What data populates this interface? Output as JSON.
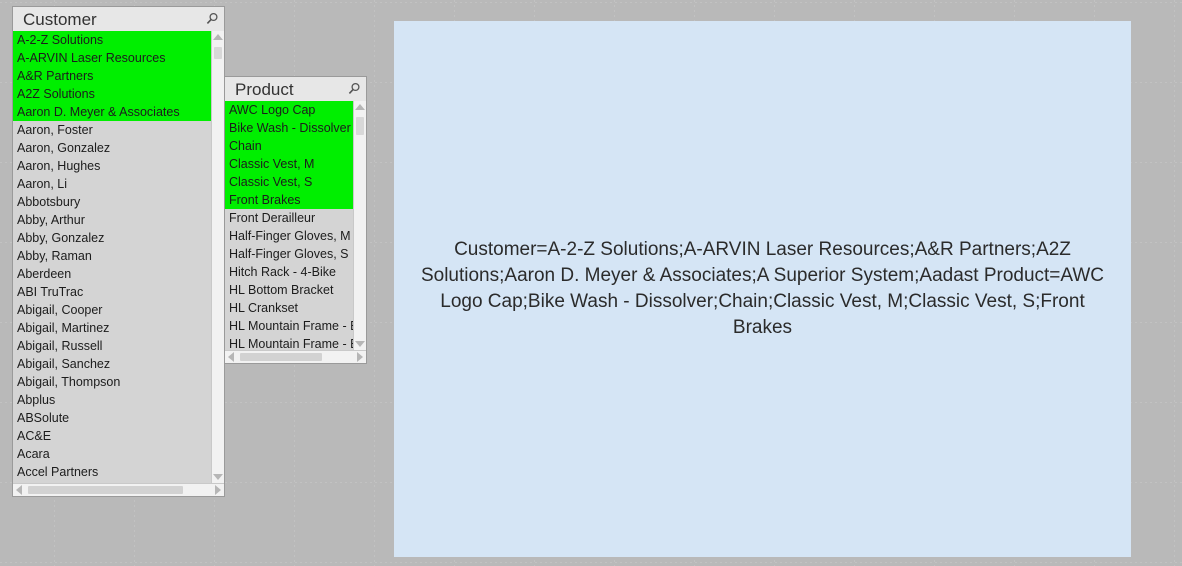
{
  "customer_listbox": {
    "title": "Customer",
    "search_icon": "search-icon",
    "items": [
      {
        "label": "A-2-Z Solutions",
        "selected": true
      },
      {
        "label": "A-ARVIN Laser Resources",
        "selected": true
      },
      {
        "label": "A&R Partners",
        "selected": true
      },
      {
        "label": "A2Z Solutions",
        "selected": true
      },
      {
        "label": "Aaron D. Meyer & Associates",
        "selected": true
      },
      {
        "label": "Aaron, Foster",
        "selected": false
      },
      {
        "label": "Aaron, Gonzalez",
        "selected": false
      },
      {
        "label": "Aaron, Hughes",
        "selected": false
      },
      {
        "label": "Aaron, Li",
        "selected": false
      },
      {
        "label": "Abbotsbury",
        "selected": false
      },
      {
        "label": "Abby, Arthur",
        "selected": false
      },
      {
        "label": "Abby, Gonzalez",
        "selected": false
      },
      {
        "label": "Abby, Raman",
        "selected": false
      },
      {
        "label": "Aberdeen",
        "selected": false
      },
      {
        "label": "ABI TruTrac",
        "selected": false
      },
      {
        "label": "Abigail, Cooper",
        "selected": false
      },
      {
        "label": "Abigail, Martinez",
        "selected": false
      },
      {
        "label": "Abigail, Russell",
        "selected": false
      },
      {
        "label": "Abigail, Sanchez",
        "selected": false
      },
      {
        "label": "Abigail, Thompson",
        "selected": false
      },
      {
        "label": "Abplus",
        "selected": false
      },
      {
        "label": "ABSolute",
        "selected": false
      },
      {
        "label": "AC&E",
        "selected": false
      },
      {
        "label": "Acara",
        "selected": false
      },
      {
        "label": "Accel Partners",
        "selected": false
      }
    ]
  },
  "product_listbox": {
    "title": "Product",
    "search_icon": "search-icon",
    "items": [
      {
        "label": "AWC Logo Cap",
        "selected": true
      },
      {
        "label": "Bike Wash - Dissolver",
        "selected": true
      },
      {
        "label": "Chain",
        "selected": true
      },
      {
        "label": "Classic Vest, M",
        "selected": true
      },
      {
        "label": "Classic Vest, S",
        "selected": true
      },
      {
        "label": "Front Brakes",
        "selected": true
      },
      {
        "label": "Front Derailleur",
        "selected": false
      },
      {
        "label": "Half-Finger Gloves, M",
        "selected": false
      },
      {
        "label": "Half-Finger Gloves, S",
        "selected": false
      },
      {
        "label": "Hitch Rack - 4-Bike",
        "selected": false
      },
      {
        "label": "HL Bottom Bracket",
        "selected": false
      },
      {
        "label": "HL Crankset",
        "selected": false
      },
      {
        "label": "HL Mountain Frame - B",
        "selected": false
      },
      {
        "label": "HL Mountain Frame - B",
        "selected": false
      }
    ]
  },
  "text_object": {
    "content": "Customer=A-2-Z Solutions;A-ARVIN Laser Resources;A&R Partners;A2Z Solutions;Aaron D. Meyer & Associates;A Superior System;Aadast Product=AWC Logo Cap;Bike Wash - Dissolver;Chain;Classic Vest, M;Classic Vest, S;Front Brakes",
    "background_color": "#d5e5f5"
  },
  "colors": {
    "selected_green": "#00ef00",
    "listbox_body": "#d4d4d4",
    "listbox_caption": "#e7e7e7",
    "canvas": "#f7f7f7",
    "gridline": "#c2c2c2"
  }
}
